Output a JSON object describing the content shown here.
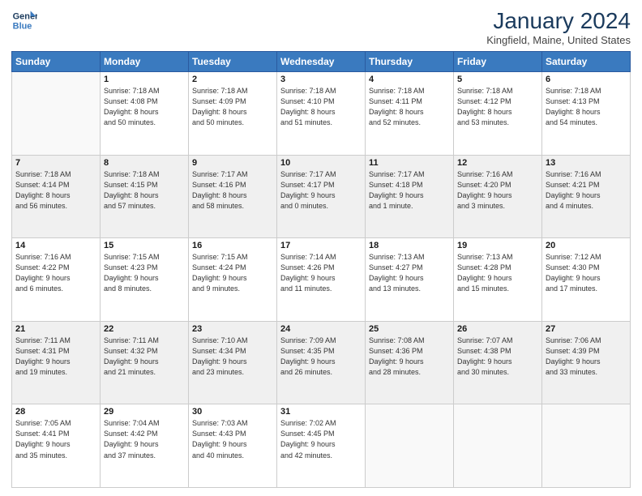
{
  "header": {
    "logo_line1": "General",
    "logo_line2": "Blue",
    "title": "January 2024",
    "subtitle": "Kingfield, Maine, United States"
  },
  "weekdays": [
    "Sunday",
    "Monday",
    "Tuesday",
    "Wednesday",
    "Thursday",
    "Friday",
    "Saturday"
  ],
  "weeks": [
    [
      {
        "day": "",
        "sunrise": "",
        "sunset": "",
        "daylight": ""
      },
      {
        "day": "1",
        "sunrise": "Sunrise: 7:18 AM",
        "sunset": "Sunset: 4:08 PM",
        "daylight": "Daylight: 8 hours and 50 minutes."
      },
      {
        "day": "2",
        "sunrise": "Sunrise: 7:18 AM",
        "sunset": "Sunset: 4:09 PM",
        "daylight": "Daylight: 8 hours and 50 minutes."
      },
      {
        "day": "3",
        "sunrise": "Sunrise: 7:18 AM",
        "sunset": "Sunset: 4:10 PM",
        "daylight": "Daylight: 8 hours and 51 minutes."
      },
      {
        "day": "4",
        "sunrise": "Sunrise: 7:18 AM",
        "sunset": "Sunset: 4:11 PM",
        "daylight": "Daylight: 8 hours and 52 minutes."
      },
      {
        "day": "5",
        "sunrise": "Sunrise: 7:18 AM",
        "sunset": "Sunset: 4:12 PM",
        "daylight": "Daylight: 8 hours and 53 minutes."
      },
      {
        "day": "6",
        "sunrise": "Sunrise: 7:18 AM",
        "sunset": "Sunset: 4:13 PM",
        "daylight": "Daylight: 8 hours and 54 minutes."
      }
    ],
    [
      {
        "day": "7",
        "sunrise": "Sunrise: 7:18 AM",
        "sunset": "Sunset: 4:14 PM",
        "daylight": "Daylight: 8 hours and 56 minutes."
      },
      {
        "day": "8",
        "sunrise": "Sunrise: 7:18 AM",
        "sunset": "Sunset: 4:15 PM",
        "daylight": "Daylight: 8 hours and 57 minutes."
      },
      {
        "day": "9",
        "sunrise": "Sunrise: 7:17 AM",
        "sunset": "Sunset: 4:16 PM",
        "daylight": "Daylight: 8 hours and 58 minutes."
      },
      {
        "day": "10",
        "sunrise": "Sunrise: 7:17 AM",
        "sunset": "Sunset: 4:17 PM",
        "daylight": "Daylight: 9 hours and 0 minutes."
      },
      {
        "day": "11",
        "sunrise": "Sunrise: 7:17 AM",
        "sunset": "Sunset: 4:18 PM",
        "daylight": "Daylight: 9 hours and 1 minute."
      },
      {
        "day": "12",
        "sunrise": "Sunrise: 7:16 AM",
        "sunset": "Sunset: 4:20 PM",
        "daylight": "Daylight: 9 hours and 3 minutes."
      },
      {
        "day": "13",
        "sunrise": "Sunrise: 7:16 AM",
        "sunset": "Sunset: 4:21 PM",
        "daylight": "Daylight: 9 hours and 4 minutes."
      }
    ],
    [
      {
        "day": "14",
        "sunrise": "Sunrise: 7:16 AM",
        "sunset": "Sunset: 4:22 PM",
        "daylight": "Daylight: 9 hours and 6 minutes."
      },
      {
        "day": "15",
        "sunrise": "Sunrise: 7:15 AM",
        "sunset": "Sunset: 4:23 PM",
        "daylight": "Daylight: 9 hours and 8 minutes."
      },
      {
        "day": "16",
        "sunrise": "Sunrise: 7:15 AM",
        "sunset": "Sunset: 4:24 PM",
        "daylight": "Daylight: 9 hours and 9 minutes."
      },
      {
        "day": "17",
        "sunrise": "Sunrise: 7:14 AM",
        "sunset": "Sunset: 4:26 PM",
        "daylight": "Daylight: 9 hours and 11 minutes."
      },
      {
        "day": "18",
        "sunrise": "Sunrise: 7:13 AM",
        "sunset": "Sunset: 4:27 PM",
        "daylight": "Daylight: 9 hours and 13 minutes."
      },
      {
        "day": "19",
        "sunrise": "Sunrise: 7:13 AM",
        "sunset": "Sunset: 4:28 PM",
        "daylight": "Daylight: 9 hours and 15 minutes."
      },
      {
        "day": "20",
        "sunrise": "Sunrise: 7:12 AM",
        "sunset": "Sunset: 4:30 PM",
        "daylight": "Daylight: 9 hours and 17 minutes."
      }
    ],
    [
      {
        "day": "21",
        "sunrise": "Sunrise: 7:11 AM",
        "sunset": "Sunset: 4:31 PM",
        "daylight": "Daylight: 9 hours and 19 minutes."
      },
      {
        "day": "22",
        "sunrise": "Sunrise: 7:11 AM",
        "sunset": "Sunset: 4:32 PM",
        "daylight": "Daylight: 9 hours and 21 minutes."
      },
      {
        "day": "23",
        "sunrise": "Sunrise: 7:10 AM",
        "sunset": "Sunset: 4:34 PM",
        "daylight": "Daylight: 9 hours and 23 minutes."
      },
      {
        "day": "24",
        "sunrise": "Sunrise: 7:09 AM",
        "sunset": "Sunset: 4:35 PM",
        "daylight": "Daylight: 9 hours and 26 minutes."
      },
      {
        "day": "25",
        "sunrise": "Sunrise: 7:08 AM",
        "sunset": "Sunset: 4:36 PM",
        "daylight": "Daylight: 9 hours and 28 minutes."
      },
      {
        "day": "26",
        "sunrise": "Sunrise: 7:07 AM",
        "sunset": "Sunset: 4:38 PM",
        "daylight": "Daylight: 9 hours and 30 minutes."
      },
      {
        "day": "27",
        "sunrise": "Sunrise: 7:06 AM",
        "sunset": "Sunset: 4:39 PM",
        "daylight": "Daylight: 9 hours and 33 minutes."
      }
    ],
    [
      {
        "day": "28",
        "sunrise": "Sunrise: 7:05 AM",
        "sunset": "Sunset: 4:41 PM",
        "daylight": "Daylight: 9 hours and 35 minutes."
      },
      {
        "day": "29",
        "sunrise": "Sunrise: 7:04 AM",
        "sunset": "Sunset: 4:42 PM",
        "daylight": "Daylight: 9 hours and 37 minutes."
      },
      {
        "day": "30",
        "sunrise": "Sunrise: 7:03 AM",
        "sunset": "Sunset: 4:43 PM",
        "daylight": "Daylight: 9 hours and 40 minutes."
      },
      {
        "day": "31",
        "sunrise": "Sunrise: 7:02 AM",
        "sunset": "Sunset: 4:45 PM",
        "daylight": "Daylight: 9 hours and 42 minutes."
      },
      {
        "day": "",
        "sunrise": "",
        "sunset": "",
        "daylight": ""
      },
      {
        "day": "",
        "sunrise": "",
        "sunset": "",
        "daylight": ""
      },
      {
        "day": "",
        "sunrise": "",
        "sunset": "",
        "daylight": ""
      }
    ]
  ]
}
